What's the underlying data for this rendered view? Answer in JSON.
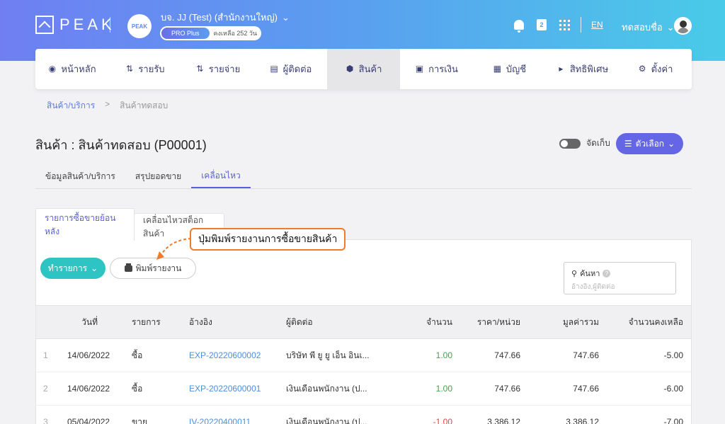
{
  "topbar": {
    "logo_text": "PEAK",
    "company_avatar_text": "PEAK",
    "company_name": "บจ. JJ (Test) (สำนักงานใหญ่)",
    "plan": "PRO Plus",
    "plan_remaining": "คงเหลือ 252 วัน",
    "language": "EN",
    "user_name": "ทดสอบชื่อ",
    "book_icon_text": "2"
  },
  "nav": {
    "items": [
      {
        "label": "หน้าหลัก",
        "icon": "home-icon"
      },
      {
        "label": "รายรับ",
        "icon": "income-icon"
      },
      {
        "label": "รายจ่าย",
        "icon": "expense-icon"
      },
      {
        "label": "ผู้ติดต่อ",
        "icon": "contacts-icon"
      },
      {
        "label": "สินค้า",
        "icon": "box-icon"
      },
      {
        "label": "การเงิน",
        "icon": "money-icon"
      },
      {
        "label": "บัญชี",
        "icon": "ledger-icon"
      },
      {
        "label": "สิทธิพิเศษ",
        "icon": "megaphone-icon"
      },
      {
        "label": "ตั้งค่า",
        "icon": "gear-icon"
      }
    ],
    "active_index": 4
  },
  "breadcrumb": {
    "link": "สินค้า/บริการ",
    "separator": ">",
    "current": "สินค้าทดสอบ"
  },
  "page": {
    "title": "สินค้า : สินค้าทดสอบ (P00001)",
    "archive_label": "จัดเก็บ",
    "options_label": "ตัวเลือก"
  },
  "subtabs": [
    "ข้อมูลสินค้า/บริการ",
    "สรุปยอดขาย",
    "เคลื่อนไหว"
  ],
  "panel_tabs": [
    "รายการซื้อขายย้อนหลัง",
    "เคลื่อนไหวสต็อกสินค้า"
  ],
  "actions": {
    "action_label": "ทำรายการ",
    "print_label": "พิมพ์รายงาน"
  },
  "callout": "ปุ่มพิมพ์รายงานการซื้อขายสินค้า",
  "search": {
    "label": "ค้นหา",
    "help": "?",
    "placeholder": "อ้างอิง,ผู้ติดต่อ"
  },
  "table": {
    "headers": {
      "date": "วันที่",
      "item": "รายการ",
      "ref": "อ้างอิง",
      "contact": "ผู้ติดต่อ",
      "qty": "จำนวน",
      "price": "ราคา/หน่วย",
      "total": "มูลค่ารวม",
      "balance": "จำนวนคงเหลือ"
    },
    "rows": [
      {
        "num": "1",
        "date": "14/06/2022",
        "item": "ซื้อ",
        "ref": "EXP-20220600002",
        "contact": "บริษัท พี ยู ยู เอ็น อินเ...",
        "qty": "1.00",
        "price": "747.66",
        "total": "747.66",
        "balance": "-5.00"
      },
      {
        "num": "2",
        "date": "14/06/2022",
        "item": "ซื้อ",
        "ref": "EXP-20220600001",
        "contact": "เงินเดือนพนักงาน (ป...",
        "qty": "1.00",
        "price": "747.66",
        "total": "747.66",
        "balance": "-6.00"
      },
      {
        "num": "3",
        "date": "05/04/2022",
        "item": "ขาย",
        "ref": "IV-20220400011",
        "contact": "เงินเดือนพนักงาน (ป...",
        "qty": "-1.00",
        "price": "3,386.12",
        "total": "3,386.12",
        "balance": "-7.00"
      }
    ]
  }
}
